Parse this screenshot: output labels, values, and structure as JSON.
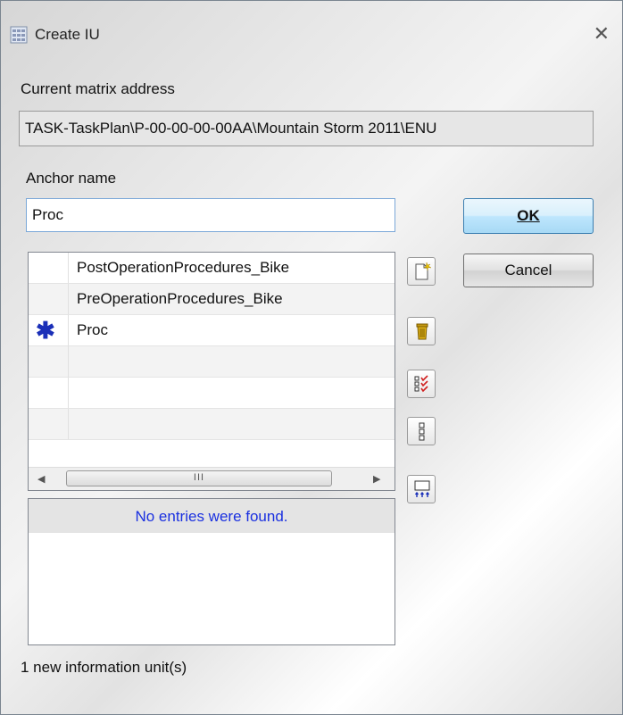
{
  "window": {
    "title": "Create IU",
    "close_glyph": "✕"
  },
  "matrix": {
    "label": "Current matrix address",
    "value": "TASK-TaskPlan\\P-00-00-00-00AA\\Mountain Storm 2011\\ENU"
  },
  "anchor": {
    "label": "Anchor name",
    "value": "Proc"
  },
  "buttons": {
    "ok": "OK",
    "cancel": "Cancel"
  },
  "list": {
    "rows": [
      {
        "name": "PostOperationProcedures_Bike",
        "marker": ""
      },
      {
        "name": "PreOperationProcedures_Bike",
        "marker": ""
      },
      {
        "name": "Proc",
        "marker": "✱"
      },
      {
        "name": "",
        "marker": ""
      },
      {
        "name": "",
        "marker": ""
      },
      {
        "name": "",
        "marker": ""
      }
    ],
    "scroll_grip": "III",
    "scroll_left": "◀",
    "scroll_right": "▶"
  },
  "results": {
    "empty_message": "No entries were found."
  },
  "toolbar_icons": [
    "new-item-icon",
    "delete-icon",
    "check-list-icon",
    "list-icon",
    "sort-icon"
  ],
  "status": {
    "text": "1 new information unit(s)"
  },
  "colors": {
    "accent": "#1a30e0",
    "marker": "#1a2fb8"
  }
}
